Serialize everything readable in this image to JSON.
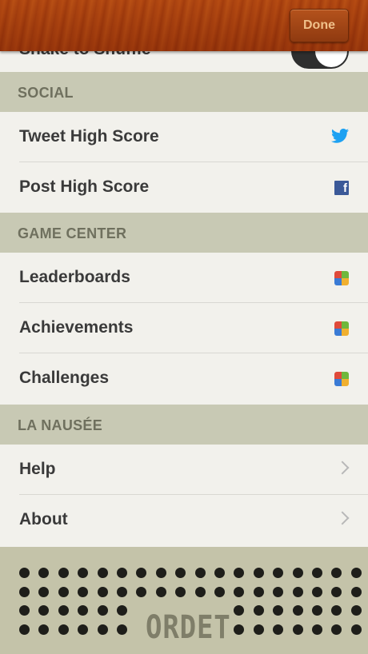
{
  "topbar": {
    "done_label": "Done"
  },
  "partial_row": {
    "label": "Shake to Shuffle"
  },
  "sections": {
    "social": {
      "title": "SOCIAL",
      "items": [
        {
          "label": "Tweet High Score",
          "icon": "twitter-icon"
        },
        {
          "label": "Post High Score",
          "icon": "facebook-icon"
        }
      ]
    },
    "game_center": {
      "title": "GAME CENTER",
      "items": [
        {
          "label": "Leaderboards",
          "icon": "game-center-icon"
        },
        {
          "label": "Achievements",
          "icon": "game-center-icon"
        },
        {
          "label": "Challenges",
          "icon": "game-center-icon"
        }
      ]
    },
    "la_nausee": {
      "title": "LA NAUSÉE",
      "items": [
        {
          "label": "Help",
          "icon": "chevron-right-icon"
        },
        {
          "label": "About",
          "icon": "chevron-right-icon"
        }
      ]
    }
  },
  "footer": {
    "logo_text": "ORDET"
  },
  "colors": {
    "twitter": "#1da1f2",
    "facebook": "#3b5998",
    "section_bg": "#c8c9b4",
    "row_bg": "#f2f1ec"
  }
}
